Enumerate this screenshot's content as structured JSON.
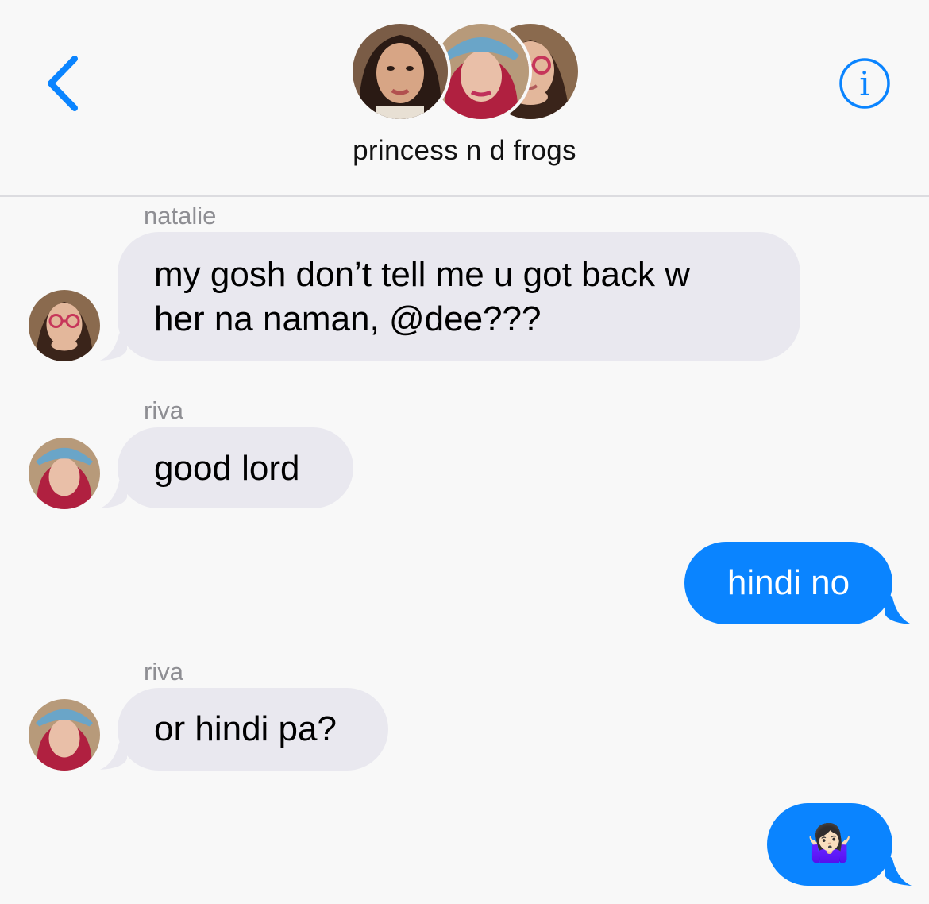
{
  "header": {
    "group_title": "princess n d frogs",
    "back_icon": "chevron-left-icon",
    "info_icon": "info-circle-icon",
    "info_glyph": "i",
    "accent_color": "#0a84ff"
  },
  "messages": [
    {
      "direction": "incoming",
      "sender": "natalie",
      "text_line1": "my gosh don’t tell me u got back w",
      "text_line2": "her na naman, @dee???"
    },
    {
      "direction": "incoming",
      "sender": "riva",
      "text": "good lord"
    },
    {
      "direction": "outgoing",
      "text": "hindi no"
    },
    {
      "direction": "incoming",
      "sender": "riva",
      "text": "or hindi pa?"
    },
    {
      "direction": "outgoing",
      "text": "🤷🏻‍♀️",
      "emoji_name": "person-shrugging"
    }
  ],
  "colors": {
    "incoming_bubble": "#e9e8ef",
    "outgoing_bubble": "#0a84ff",
    "sender_label": "#8e8e93"
  }
}
